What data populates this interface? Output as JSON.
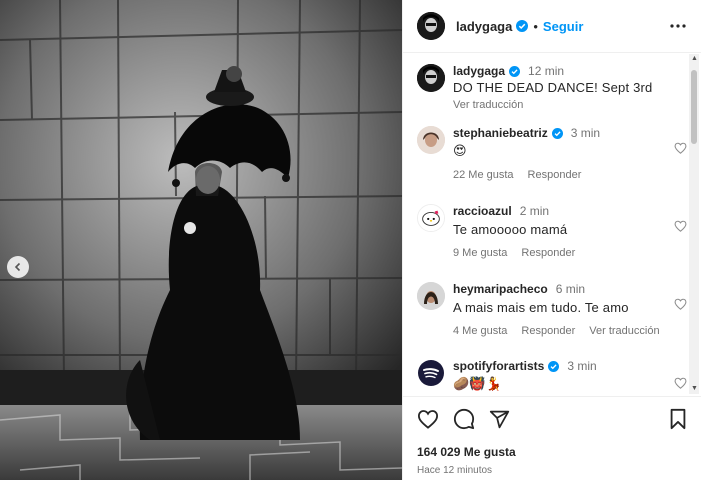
{
  "post": {
    "username": "ladygaga",
    "follow_label": "Seguir",
    "separator": "•",
    "caption_time": "12 min",
    "caption_text": "DO THE DEAD DANCE! Sept 3rd",
    "translate_label": "Ver traducción"
  },
  "comments": [
    {
      "username": "stephaniebeatriz",
      "time": "3 min",
      "text": "😍",
      "likes": "22 Me gusta",
      "reply": "Responder",
      "translate": "",
      "verified": true
    },
    {
      "username": "raccioazul",
      "time": "2 min",
      "text": "Te amooooo mamá",
      "likes": "9 Me gusta",
      "reply": "Responder",
      "translate": "",
      "verified": false
    },
    {
      "username": "heymaripacheco",
      "time": "6 min",
      "text": "A mais mais em tudo. Te amo",
      "likes": "4 Me gusta",
      "reply": "Responder",
      "translate": "Ver traducción",
      "verified": false
    },
    {
      "username": "spotifyforartists",
      "time": "3 min",
      "text": "🥔👹💃",
      "likes": "",
      "reply": "",
      "translate": "",
      "verified": true
    }
  ],
  "footer": {
    "likes_count": "164 029 Me gusta",
    "time_ago": "Hace 12 minutos"
  },
  "icons": {
    "verified": "verified-badge-icon",
    "heart": "heart-icon",
    "comment": "comment-icon",
    "share": "share-icon",
    "save": "bookmark-icon",
    "more": "more-horizontal-icon",
    "prev": "chevron-left-icon"
  },
  "colors": {
    "accent": "#0095f6",
    "text": "#262626",
    "secondary": "#737373",
    "verified": "#0095f6",
    "spotify": "#1ed760"
  }
}
